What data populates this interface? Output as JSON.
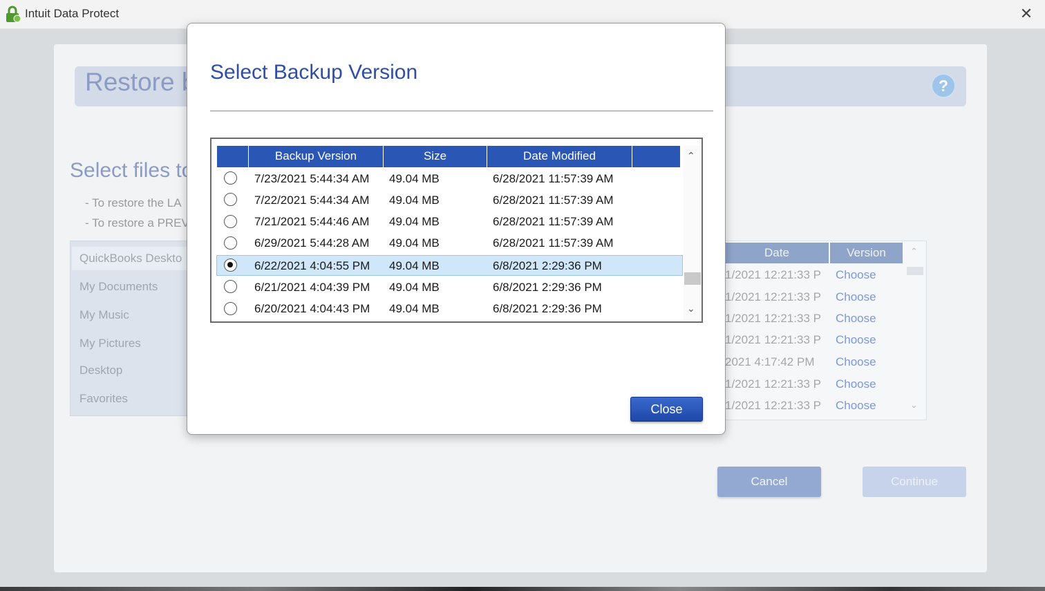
{
  "window": {
    "title": "Intuit Data Protect",
    "close_glyph": "✕"
  },
  "background": {
    "restore_title": "Restore b",
    "help_glyph": "?",
    "select_files_title": "Select files to",
    "hints": [
      "- To restore the LA",
      "- To restore a PREV"
    ],
    "left_list": [
      "QuickBooks Deskto",
      "My Documents",
      "My Music",
      "My Pictures",
      "Desktop",
      "Favorites"
    ],
    "right_table": {
      "headers": [
        "Date",
        "Version"
      ],
      "rows": [
        {
          "date": "1/2021 12:21:33 P",
          "version": "Choose"
        },
        {
          "date": "1/2021 12:21:33 P",
          "version": "Choose"
        },
        {
          "date": "1/2021 12:21:33 P",
          "version": "Choose"
        },
        {
          "date": "1/2021 12:21:33 P",
          "version": "Choose"
        },
        {
          "date": "2021 4:17:42 PM",
          "version": "Choose"
        },
        {
          "date": "1/2021 12:21:33 P",
          "version": "Choose"
        },
        {
          "date": "1/2021 12:21:33 P",
          "version": "Choose"
        }
      ]
    },
    "buttons": {
      "cancel": "Cancel",
      "continue": "Continue"
    }
  },
  "dialog": {
    "title": "Select Backup Version",
    "columns": [
      "Backup Version",
      "Size",
      "Date Modified"
    ],
    "rows": [
      {
        "version": "7/23/2021 5:44:34 AM",
        "size": "49.04 MB",
        "modified": "6/28/2021 11:57:39 AM",
        "selected": false
      },
      {
        "version": "7/22/2021 5:44:34 AM",
        "size": "49.04 MB",
        "modified": "6/28/2021 11:57:39 AM",
        "selected": false
      },
      {
        "version": "7/21/2021 5:44:46 AM",
        "size": "49.04 MB",
        "modified": "6/28/2021 11:57:39 AM",
        "selected": false
      },
      {
        "version": "6/29/2021 5:44:28 AM",
        "size": "49.04 MB",
        "modified": "6/28/2021 11:57:39 AM",
        "selected": false
      },
      {
        "version": "6/22/2021 4:04:55 PM",
        "size": "49.04 MB",
        "modified": "6/8/2021 2:29:36 PM",
        "selected": true
      },
      {
        "version": "6/21/2021 4:04:39 PM",
        "size": "49.04 MB",
        "modified": "6/8/2021 2:29:36 PM",
        "selected": false
      },
      {
        "version": "6/20/2021 4:04:43 PM",
        "size": "49.04 MB",
        "modified": "6/8/2021 2:29:36 PM",
        "selected": false
      }
    ],
    "close_label": "Close"
  }
}
